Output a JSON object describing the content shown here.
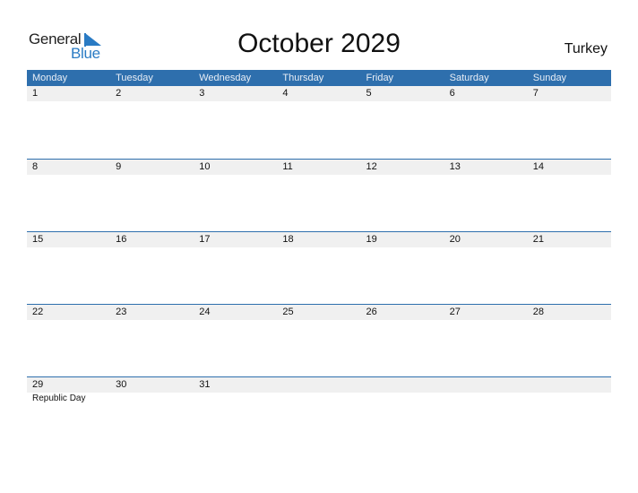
{
  "logo": {
    "general": "General",
    "blue": "Blue"
  },
  "title": "October 2029",
  "country": "Turkey",
  "colors": {
    "header_bg": "#2e6fad",
    "date_strip": "#f0f0f0",
    "brand_blue": "#2a7bc4"
  },
  "weekdays": [
    "Monday",
    "Tuesday",
    "Wednesday",
    "Thursday",
    "Friday",
    "Saturday",
    "Sunday"
  ],
  "weeks": [
    {
      "days": [
        "1",
        "2",
        "3",
        "4",
        "5",
        "6",
        "7"
      ],
      "events": [
        "",
        "",
        "",
        "",
        "",
        "",
        ""
      ]
    },
    {
      "days": [
        "8",
        "9",
        "10",
        "11",
        "12",
        "13",
        "14"
      ],
      "events": [
        "",
        "",
        "",
        "",
        "",
        "",
        ""
      ]
    },
    {
      "days": [
        "15",
        "16",
        "17",
        "18",
        "19",
        "20",
        "21"
      ],
      "events": [
        "",
        "",
        "",
        "",
        "",
        "",
        ""
      ]
    },
    {
      "days": [
        "22",
        "23",
        "24",
        "25",
        "26",
        "27",
        "28"
      ],
      "events": [
        "",
        "",
        "",
        "",
        "",
        "",
        ""
      ]
    },
    {
      "days": [
        "29",
        "30",
        "31",
        "",
        "",
        "",
        ""
      ],
      "events": [
        "Republic Day",
        "",
        "",
        "",
        "",
        "",
        ""
      ]
    }
  ]
}
